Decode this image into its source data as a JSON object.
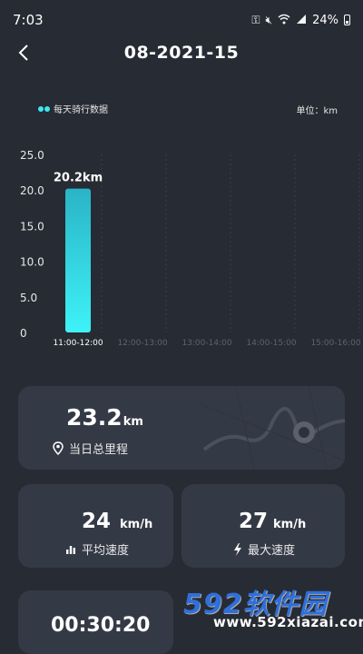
{
  "status_bar": {
    "time": "7:03",
    "battery": "24%"
  },
  "header": {
    "title": "08-2021-15"
  },
  "chart_legend": {
    "series_label": "每天骑行数据",
    "unit_label": "单位：km"
  },
  "chart_data": {
    "type": "bar",
    "categories": [
      "11:00-12:00",
      "12:00-13:00",
      "13:00-14:00",
      "14:00-15:00",
      "15:00-16:00"
    ],
    "values": [
      20.2,
      0,
      0,
      0,
      0
    ],
    "y_ticks": [
      "0",
      "5.0",
      "10.0",
      "15.0",
      "20.0",
      "25.0"
    ],
    "ylim": [
      0,
      25
    ],
    "data_labels": [
      "20.2km",
      "",
      "",
      "",
      ""
    ],
    "colors": {
      "bar_top": "#2ab4c6",
      "bar_bottom": "#3ef2f8",
      "grid": "#3a404b"
    }
  },
  "stats": {
    "total_distance": {
      "value": "23.2",
      "unit": "km",
      "label": "当日总里程"
    },
    "avg_speed": {
      "value": "24",
      "unit": "km/h",
      "label": "平均速度"
    },
    "max_speed": {
      "value": "27",
      "unit": "km/h",
      "label": "最大速度"
    },
    "duration": {
      "value": "00:30:20"
    }
  },
  "watermark": {
    "logo_text": "592软件园",
    "url": "www.592xiazai.com"
  }
}
